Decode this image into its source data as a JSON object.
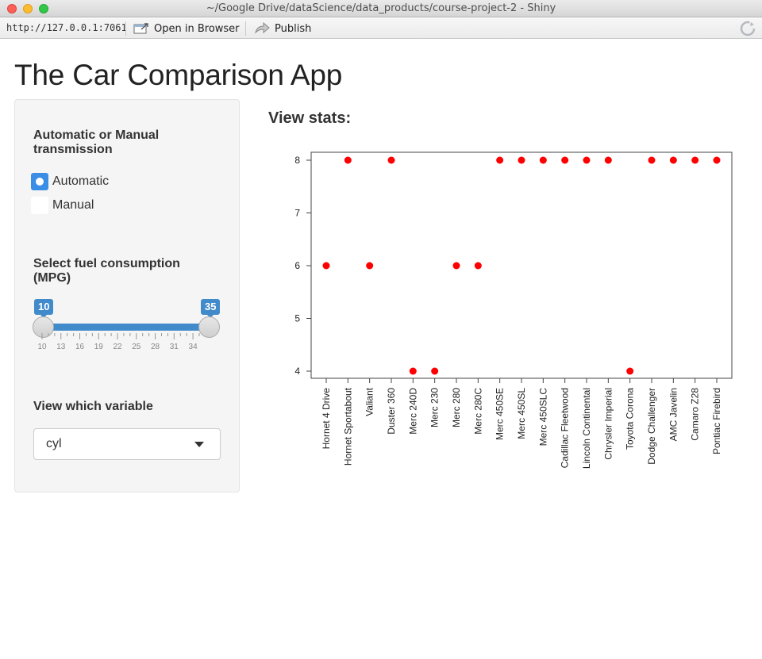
{
  "window": {
    "title": "~/Google Drive/dataScience/data_products/course-project-2 - Shiny"
  },
  "toolbar": {
    "url": "http://127.0.0.1:7061",
    "open_in_browser": "Open in Browser",
    "publish": "Publish"
  },
  "app": {
    "title": "The Car Comparison App"
  },
  "sidebar": {
    "transmission_label": "Automatic or Manual transmission",
    "transmission_options": [
      {
        "label": "Automatic",
        "selected": true
      },
      {
        "label": "Manual",
        "selected": false
      }
    ],
    "mpg_label": "Select fuel consumption (MPG)",
    "mpg_slider": {
      "min_value": "10",
      "max_value": "35",
      "tick_labels": [
        "10",
        "13",
        "16",
        "19",
        "22",
        "25",
        "28",
        "31",
        "34"
      ]
    },
    "variable_label": "View which variable",
    "variable_selected": "cyl"
  },
  "main": {
    "heading": "View stats:"
  },
  "colors": {
    "accent": "#428bca",
    "point": "#ff0000"
  },
  "chart_data": {
    "type": "scatter",
    "title": "",
    "xlabel": "",
    "ylabel": "",
    "ylim": [
      4,
      8
    ],
    "yticks": [
      "4",
      "5",
      "6",
      "7",
      "8"
    ],
    "categories": [
      "Hornet 4 Drive",
      "Hornet Sportabout",
      "Valiant",
      "Duster 360",
      "Merc 240D",
      "Merc 230",
      "Merc 280",
      "Merc 280C",
      "Merc 450SE",
      "Merc 450SL",
      "Merc 450SLC",
      "Cadillac Fleetwood",
      "Lincoln Continental",
      "Chrysler Imperial",
      "Toyota Corona",
      "Dodge Challenger",
      "AMC Javelin",
      "Camaro Z28",
      "Pontiac Firebird"
    ],
    "values": [
      6,
      8,
      6,
      8,
      4,
      4,
      6,
      6,
      8,
      8,
      8,
      8,
      8,
      8,
      4,
      8,
      8,
      8,
      8
    ],
    "grid": false,
    "legend": "none"
  }
}
